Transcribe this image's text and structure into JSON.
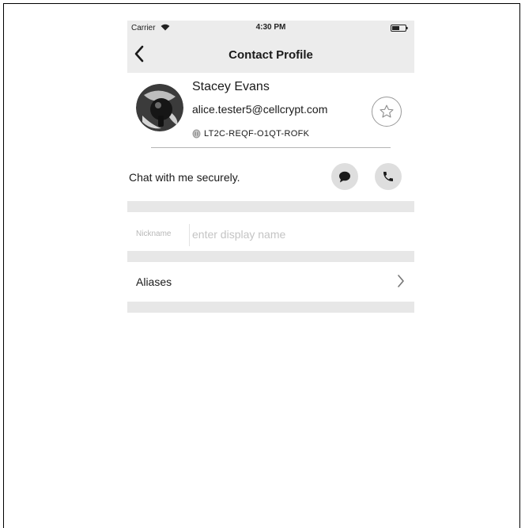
{
  "status_bar": {
    "carrier": "Carrier",
    "time": "4:30 PM"
  },
  "nav": {
    "title": "Contact Profile",
    "back_icon": "chevron-left-icon"
  },
  "contact": {
    "name": "Stacey Evans",
    "email": "alice.tester5@cellcrypt.com",
    "fingerprint_code": "LT2C-REQF-O1QT-ROFK",
    "status_message": "Chat with me securely.",
    "favorite_icon": "star-outline-icon"
  },
  "actions": {
    "chat_icon": "chat-bubble-icon",
    "call_icon": "phone-icon"
  },
  "nickname": {
    "label": "Nickname",
    "value": "",
    "placeholder": "enter display name"
  },
  "aliases": {
    "label": "Aliases",
    "icon": "chevron-right-icon"
  },
  "colors": {
    "nav_background": "#ececec",
    "section_gap": "#e7e7e7",
    "action_button": "#dedede"
  }
}
